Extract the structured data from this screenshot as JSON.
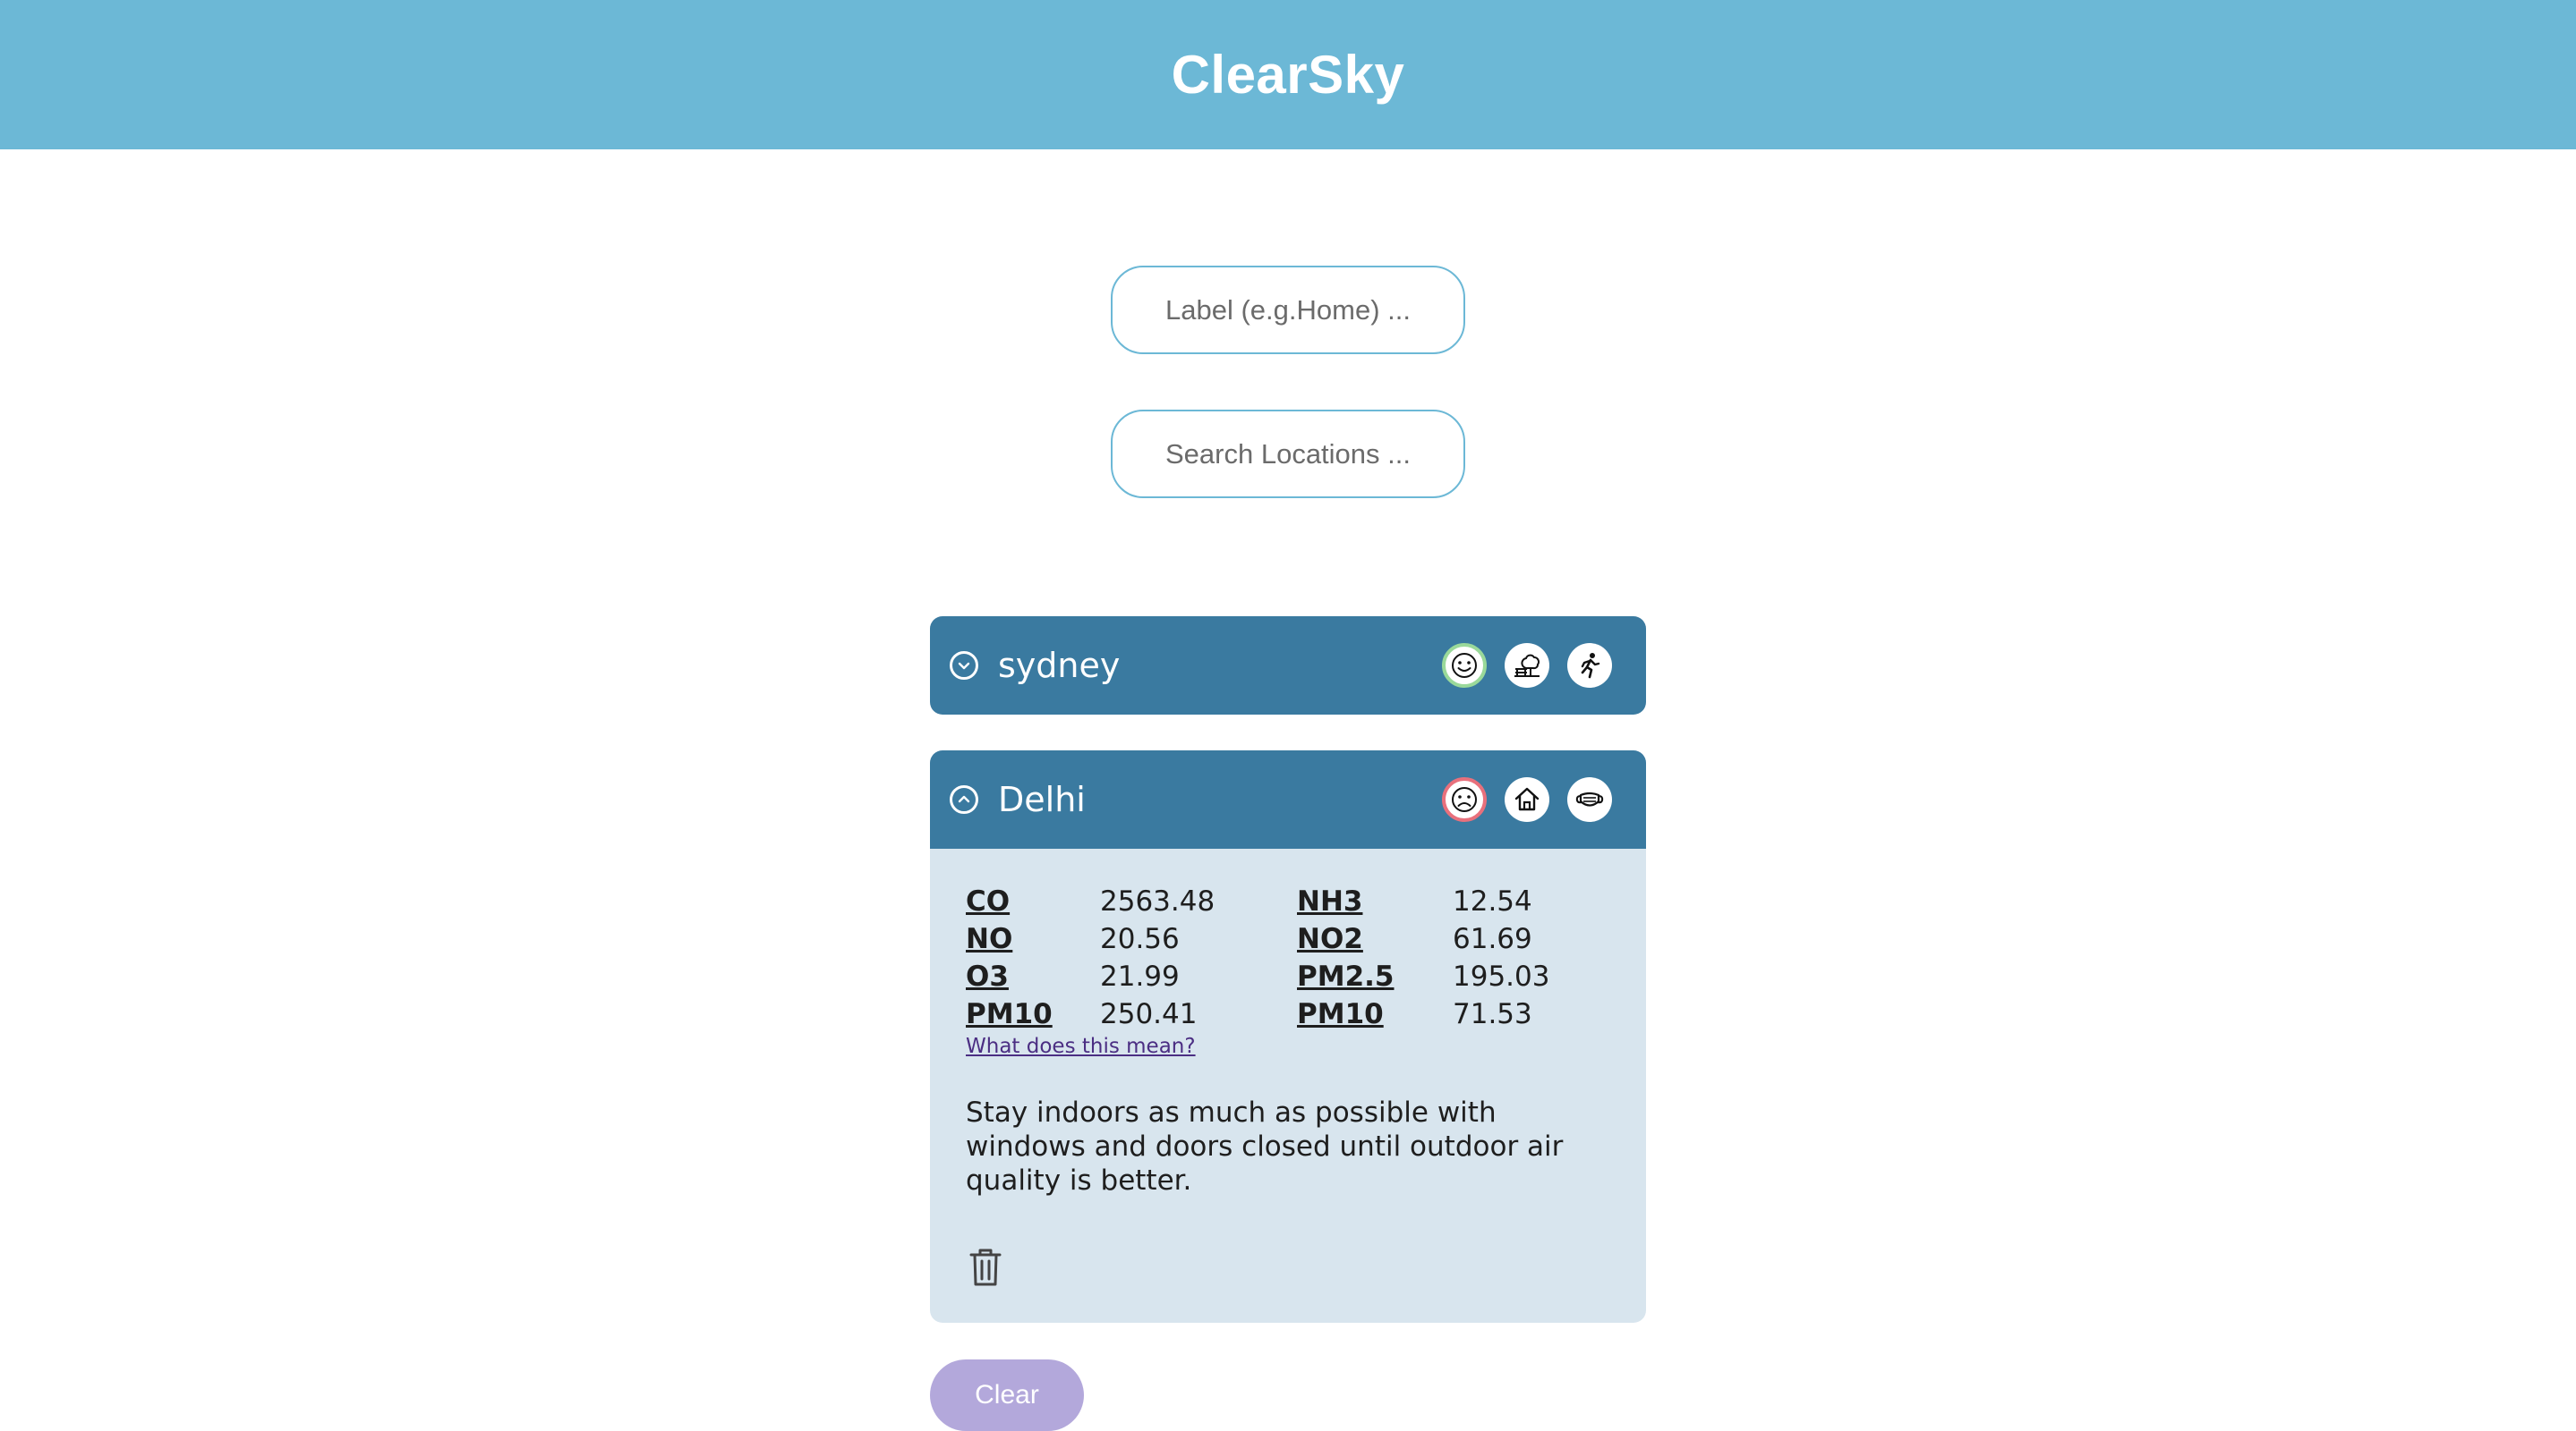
{
  "header": {
    "title": "ClearSky"
  },
  "form": {
    "label_placeholder": "Label (e.g.Home) ...",
    "search_placeholder": "Search Locations ..."
  },
  "locations": [
    {
      "name": "sydney",
      "expanded": false,
      "badges": [
        "smile-icon",
        "park-bench-icon",
        "running-person-icon"
      ]
    },
    {
      "name": "Delhi",
      "expanded": true,
      "badges": [
        "frown-icon",
        "home-icon",
        "face-mask-icon"
      ],
      "readings": [
        {
          "pollutant": "CO",
          "value": "2563.48"
        },
        {
          "pollutant": "NH3",
          "value": "12.54"
        },
        {
          "pollutant": "NO",
          "value": "20.56"
        },
        {
          "pollutant": "NO2",
          "value": "61.69"
        },
        {
          "pollutant": "O3",
          "value": "21.99"
        },
        {
          "pollutant": "PM2.5",
          "value": "195.03"
        },
        {
          "pollutant": "PM10",
          "value": "250.41"
        },
        {
          "pollutant": "PM10",
          "value": "71.53"
        }
      ],
      "meaning_link": "What does this mean?",
      "advice": "Stay indoors as much as possible with windows and doors closed until outdoor air quality is better."
    }
  ],
  "clear_label": "Clear",
  "colors": {
    "header": "#6cb8d6",
    "card_header": "#3a7aa0",
    "card_body": "#d8e5ee",
    "good_ring": "#9ad99a",
    "bad_ring": "#e8707c",
    "clear_button": "#b3a8db"
  }
}
